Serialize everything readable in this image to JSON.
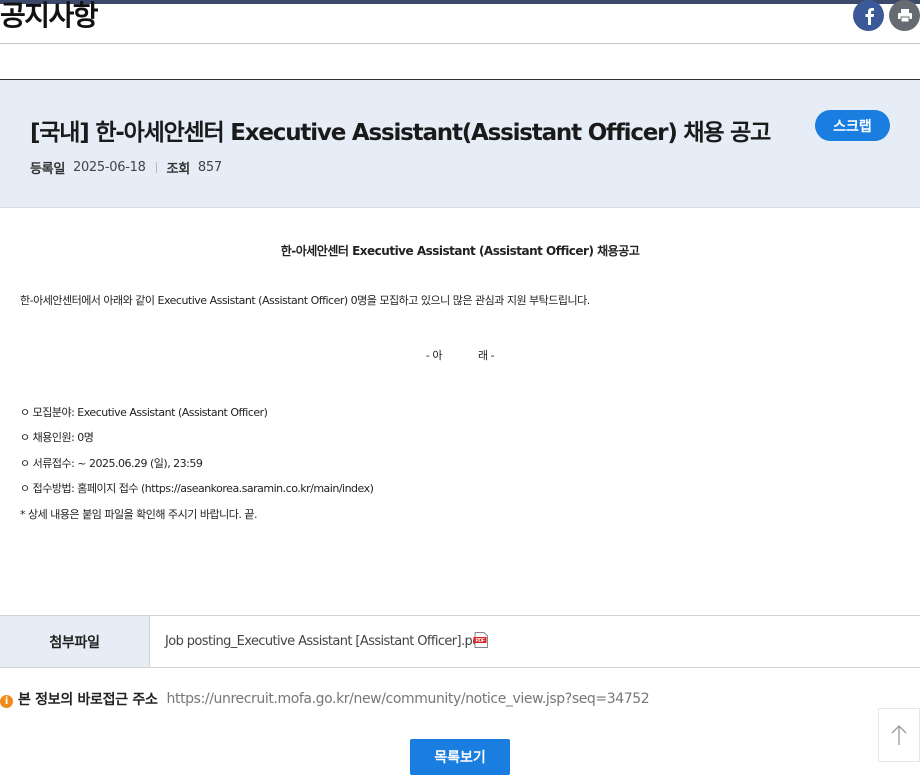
{
  "page_title": "공지사항",
  "share": {
    "facebook_icon": "facebook-icon",
    "print_icon": "print-icon"
  },
  "notice": {
    "title": "[국내] 한-아세안센터 Executive Assistant(Assistant Officer) 채용 공고",
    "scrap_label": "스크랩",
    "date_label": "등록일",
    "date_value": "2025-06-18",
    "views_label": "조회",
    "views_value": "857"
  },
  "body": {
    "heading": "한-아세안센터 Executive Assistant (Assistant Officer) 채용공고",
    "intro": "한-아세안센터에서 아래와 같이 Executive Assistant (Assistant Officer) 0명을 모집하고 있으니 많은 관심과 지원 부탁드립니다.",
    "arae": "- 아            래 -",
    "items": [
      "ㅇ 모집분야: Executive Assistant (Assistant Officer)",
      "ㅇ 채용인원: 0명",
      "ㅇ 서류접수: ~ 2025.06.29 (일), 23:59",
      "ㅇ 접수방법: 홈페이지 접수 (https://aseankorea.saramin.co.kr/main/index)"
    ],
    "note": "* 상세 내용은 붙임 파일을 확인해 주시기 바랍니다.  끝."
  },
  "attachment": {
    "label": "첨부파일",
    "file_name": "Job posting_Executive Assistant [Assistant Officer].pdf",
    "file_icon": "pdf-icon"
  },
  "direct_link": {
    "label": "본 정보의 바로접근 주소",
    "url": "https://unrecruit.mofa.go.kr/new/community/notice_view.jsp?seq=34752"
  },
  "list_button_label": "목록보기",
  "colors": {
    "accent": "#1a7de0",
    "header_bg": "#e6edf6",
    "facebook": "#3b5998",
    "info": "#f08a1a"
  }
}
